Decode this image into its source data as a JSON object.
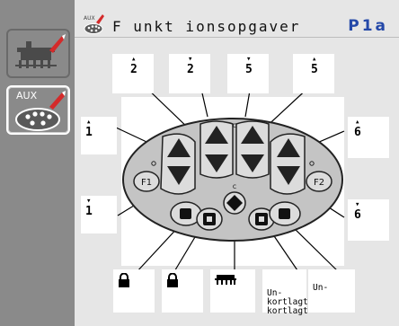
{
  "header": {
    "title": "F unkt ionsopgaver",
    "page_id": "P1a"
  },
  "softkeys": [
    {
      "id": "drill-settings",
      "icon": "seeder-raise-icon",
      "active": false
    },
    {
      "id": "aux",
      "label": "AUX",
      "icon": "aux-controller-icon",
      "active": true
    }
  ],
  "labels": {
    "top": [
      "2",
      "2",
      "5",
      "5"
    ],
    "left_top": "1",
    "left_bottom": "1",
    "right_top": "6",
    "right_bottom": "6",
    "bottom": [
      {
        "icon": "lock-icon",
        "text": ""
      },
      {
        "icon": "lock-icon",
        "text": ""
      },
      {
        "icon": "frame-icon",
        "text": ""
      },
      {
        "icon": "",
        "text": "Un-\nkortlagt\nkortlagt"
      },
      {
        "icon": "",
        "text": "Un-"
      }
    ]
  },
  "joystick": {
    "buttons": [
      "F1",
      "F2"
    ],
    "small_labels": [
      "c",
      "c",
      "c"
    ]
  },
  "colors": {
    "background": "#e6e6e6",
    "sidebar": "#8a8a8a",
    "page_id": "#2448a8",
    "accent": "#c8202a",
    "controller_body": "#c2c2c2"
  }
}
